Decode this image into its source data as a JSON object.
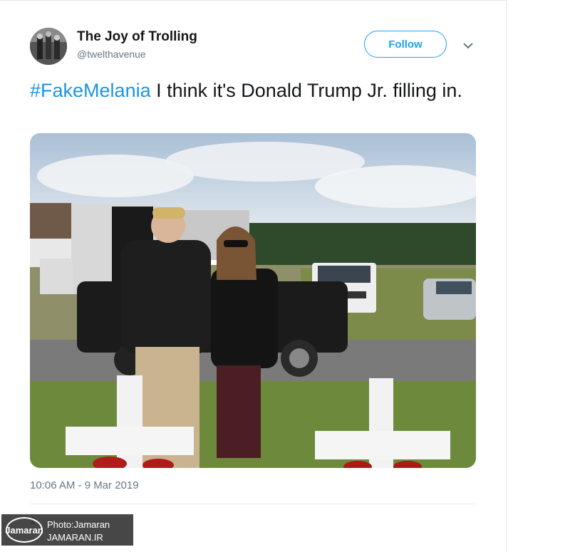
{
  "tweet": {
    "display_name": "The Joy of Trolling",
    "handle": "@twelthavenue",
    "follow_label": "Follow",
    "hashtag": "#FakeMelania",
    "text": " I think it's Donald Trump Jr. filling in.",
    "timestamp": "10:06 AM - 9 Mar 2019"
  },
  "footer": {
    "partial_count": "1"
  },
  "watermark": {
    "logo_text": "Jamaran",
    "line1": "Photo:Jamaran",
    "line2": "JAMARAN.IR"
  },
  "colors": {
    "accent": "#1da1f2",
    "hashtag": "#1b95e0",
    "secondary_text": "#657786"
  },
  "icons": [
    "avatar-photo",
    "chevron-down-icon",
    "jamaran-logo"
  ]
}
